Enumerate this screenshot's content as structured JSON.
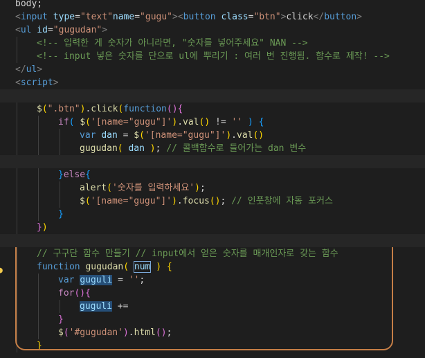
{
  "editor": {
    "lines": [
      {
        "indent": 0,
        "segments": [
          [
            "body;",
            "c-txt"
          ]
        ]
      },
      {
        "indent": 0,
        "segments": [
          [
            "<",
            "c-punc"
          ],
          [
            "input",
            "c-tag"
          ],
          [
            " type",
            "c-attr"
          ],
          [
            "=",
            "c-txt"
          ],
          [
            "\"text\"",
            "c-str"
          ],
          [
            "name",
            "c-attr"
          ],
          [
            "=",
            "c-txt"
          ],
          [
            "\"gugu\"",
            "c-str"
          ],
          [
            ">",
            "c-punc"
          ],
          [
            "<",
            "c-punc"
          ],
          [
            "button",
            "c-tag"
          ],
          [
            " class",
            "c-attr"
          ],
          [
            "=",
            "c-txt"
          ],
          [
            "\"btn\"",
            "c-str"
          ],
          [
            ">",
            "c-punc"
          ],
          [
            "click",
            "c-txt"
          ],
          [
            "</",
            "c-punc"
          ],
          [
            "button",
            "c-tag"
          ],
          [
            ">",
            "c-punc"
          ]
        ]
      },
      {
        "indent": 0,
        "segments": [
          [
            "<",
            "c-punc"
          ],
          [
            "ul",
            "c-tag"
          ],
          [
            " id",
            "c-attr"
          ],
          [
            "=",
            "c-txt"
          ],
          [
            "\"gugudan\"",
            "c-str"
          ],
          [
            ">",
            "c-punc"
          ]
        ]
      },
      {
        "indent": 1,
        "segments": [
          [
            "<!-- 입력한 게 숫자가 아니라면, \"숫자를 넣어주세요\" NAN -->",
            "c-cmt"
          ]
        ]
      },
      {
        "indent": 1,
        "segments": [
          [
            "<!-- input 넣은 숫자를 단으로 ul에 뿌리기 : 여러 번 진행됨. 함수로 제작! -->",
            "c-cmt"
          ]
        ]
      },
      {
        "indent": 0,
        "segments": [
          [
            "</",
            "c-punc"
          ],
          [
            "ul",
            "c-tag"
          ],
          [
            ">",
            "c-punc"
          ]
        ]
      },
      {
        "indent": 0,
        "segments": [
          [
            "<",
            "c-punc"
          ],
          [
            "script",
            "c-tag"
          ],
          [
            ">",
            "c-punc"
          ]
        ]
      },
      {
        "indent": 0,
        "segments": [],
        "blank": true
      },
      {
        "indent": 1,
        "segments": [
          [
            "$",
            "c-fn"
          ],
          [
            "(",
            "c-b1"
          ],
          [
            "\".btn\"",
            "c-str"
          ],
          [
            ")",
            "c-b1"
          ],
          [
            ".",
            "c-txt"
          ],
          [
            "click",
            "c-fn"
          ],
          [
            "(",
            "c-b1"
          ],
          [
            "function",
            "c-kw"
          ],
          [
            "()",
            "c-b2"
          ],
          [
            "{",
            "c-b2"
          ]
        ]
      },
      {
        "indent": 2,
        "segments": [
          [
            "if",
            "c-ctl"
          ],
          [
            "(",
            "c-b3"
          ],
          [
            " ",
            "c-txt"
          ],
          [
            "$",
            "c-fn"
          ],
          [
            "(",
            "c-b1"
          ],
          [
            "'[name=\"gugu\"]'",
            "c-str"
          ],
          [
            ")",
            "c-b1"
          ],
          [
            ".",
            "c-txt"
          ],
          [
            "val",
            "c-fn"
          ],
          [
            "()",
            "c-b1"
          ],
          [
            " != ",
            "c-txt"
          ],
          [
            "''",
            "c-str"
          ],
          [
            " ",
            "c-txt"
          ],
          [
            ")",
            "c-b3"
          ],
          [
            " ",
            "c-txt"
          ],
          [
            "{",
            "c-b3"
          ]
        ]
      },
      {
        "indent": 3,
        "segments": [
          [
            "var",
            "c-kw"
          ],
          [
            " ",
            "c-txt"
          ],
          [
            "dan",
            "c-var"
          ],
          [
            " = ",
            "c-txt"
          ],
          [
            "$",
            "c-fn"
          ],
          [
            "(",
            "c-b1"
          ],
          [
            "'[name=\"gugu\"]'",
            "c-str"
          ],
          [
            ")",
            "c-b1"
          ],
          [
            ".",
            "c-txt"
          ],
          [
            "val",
            "c-fn"
          ],
          [
            "()",
            "c-b1"
          ]
        ]
      },
      {
        "indent": 3,
        "segments": [
          [
            "gugudan",
            "c-fn"
          ],
          [
            "(",
            "c-b1"
          ],
          [
            " ",
            "c-txt"
          ],
          [
            "dan",
            "c-var"
          ],
          [
            " ",
            "c-txt"
          ],
          [
            ")",
            "c-b1"
          ],
          [
            "; ",
            "c-txt"
          ],
          [
            "// 콜백함수로 들어가는 dan 변수",
            "c-cmt"
          ]
        ]
      },
      {
        "indent": 0,
        "segments": [],
        "blank": true
      },
      {
        "indent": 2,
        "segments": [
          [
            "}",
            "c-b3"
          ],
          [
            "else",
            "c-ctl"
          ],
          [
            "{",
            "c-b3"
          ]
        ]
      },
      {
        "indent": 3,
        "segments": [
          [
            "alert",
            "c-fn"
          ],
          [
            "(",
            "c-b1"
          ],
          [
            "'숫자를 입력하세요'",
            "c-str"
          ],
          [
            ")",
            "c-b1"
          ],
          [
            ";",
            "c-txt"
          ]
        ]
      },
      {
        "indent": 3,
        "segments": [
          [
            "$",
            "c-fn"
          ],
          [
            "(",
            "c-b1"
          ],
          [
            "'[name=\"gugu\"]'",
            "c-str"
          ],
          [
            ")",
            "c-b1"
          ],
          [
            ".",
            "c-txt"
          ],
          [
            "focus",
            "c-fn"
          ],
          [
            "()",
            "c-b1"
          ],
          [
            "; ",
            "c-txt"
          ],
          [
            "// 인풋창에 자동 포커스",
            "c-cmt"
          ]
        ]
      },
      {
        "indent": 2,
        "segments": [
          [
            "}",
            "c-b3"
          ]
        ]
      },
      {
        "indent": 1,
        "segments": [
          [
            "}",
            "c-b2"
          ],
          [
            ")",
            "c-b1"
          ]
        ]
      },
      {
        "indent": 0,
        "segments": [],
        "blank": true
      },
      {
        "indent": 1,
        "segments": [
          [
            "// 구구단 함수 만들기 // input에서 얻은 숫자를 매개인자로 갖는 함수",
            "c-cmt"
          ]
        ]
      },
      {
        "indent": 1,
        "segments": [
          [
            "function",
            "c-kw"
          ],
          [
            " ",
            "c-txt"
          ],
          [
            "gugudan",
            "c-fn"
          ],
          [
            "(",
            "c-b1"
          ],
          [
            " ",
            "c-txt"
          ],
          [
            "num",
            "c-var word-box"
          ],
          [
            " ",
            "c-txt"
          ],
          [
            ")",
            "c-b1"
          ],
          [
            " ",
            "c-txt"
          ],
          [
            "{",
            "c-b1"
          ]
        ]
      },
      {
        "indent": 2,
        "segments": [
          [
            "var",
            "c-kw"
          ],
          [
            " ",
            "c-txt"
          ],
          [
            "guguli",
            "c-var word-hl"
          ],
          [
            " = ",
            "c-txt"
          ],
          [
            "''",
            "c-str"
          ],
          [
            ";",
            "c-txt"
          ]
        ]
      },
      {
        "indent": 2,
        "segments": [
          [
            "for",
            "c-ctl"
          ],
          [
            "()",
            "c-b2"
          ],
          [
            "{",
            "c-b2"
          ]
        ]
      },
      {
        "indent": 3,
        "segments": [
          [
            "guguli",
            "c-var word-hl"
          ],
          [
            " +=",
            "c-txt"
          ]
        ]
      },
      {
        "indent": 2,
        "segments": [
          [
            "}",
            "c-b2"
          ]
        ]
      },
      {
        "indent": 2,
        "segments": [
          [
            "$",
            "c-fn"
          ],
          [
            "(",
            "c-b2"
          ],
          [
            "'#gugudan'",
            "c-str"
          ],
          [
            ")",
            "c-b2"
          ],
          [
            ".",
            "c-txt"
          ],
          [
            "html",
            "c-fn"
          ],
          [
            "()",
            "c-b2"
          ],
          [
            ";",
            "c-txt"
          ]
        ]
      },
      {
        "indent": 1,
        "segments": [
          [
            "}",
            "c-b1"
          ]
        ]
      }
    ]
  }
}
